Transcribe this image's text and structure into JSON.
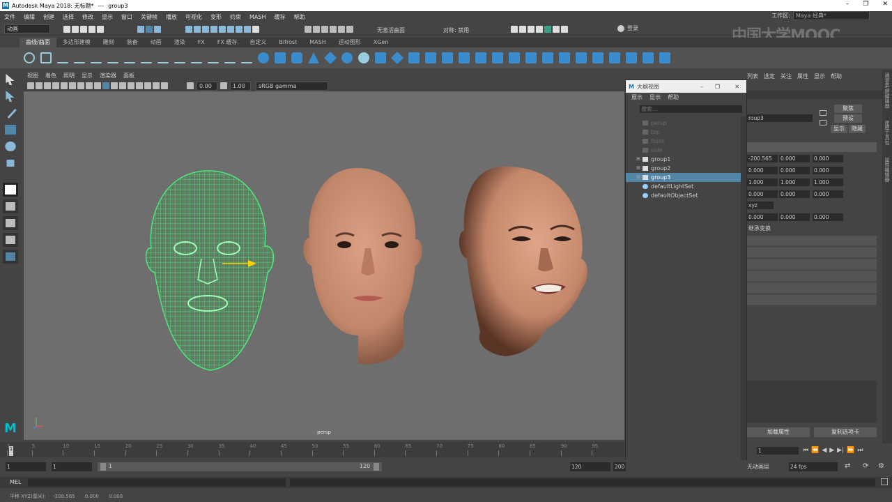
{
  "titlebar": {
    "app": "Autodesk Maya 2018: 无标题*",
    "sep": "---",
    "object": "group3",
    "controls": [
      "–",
      "❐",
      "✕"
    ]
  },
  "menubar": [
    "文件",
    "编辑",
    "创建",
    "选择",
    "修改",
    "显示",
    "窗口",
    "关键帧",
    "播放",
    "可视化",
    "变形",
    "约束",
    "MASH",
    "缓存",
    "帮助"
  ],
  "workspace": {
    "label": "工作区:",
    "value": "Maya 经典*"
  },
  "statusline": {
    "mode": "动画",
    "live_surface": "无激活曲面",
    "symmetry": "对称: 禁用",
    "login": "登录"
  },
  "watermark": "中国大学MOOC",
  "shelf_tabs": [
    "曲线/曲面",
    "多边形建模",
    "雕刻",
    "装备",
    "动画",
    "渲染",
    "FX",
    "FX 缓存",
    "自定义",
    "Bifrost",
    "MASH",
    "运动图形",
    "XGen"
  ],
  "viewport": {
    "menu": [
      "视图",
      "着色",
      "照明",
      "显示",
      "渲染器",
      "面板"
    ],
    "field1": "0.00",
    "field2": "1.00",
    "color_space": "sRGB gamma",
    "camera_label": "persp"
  },
  "outliner": {
    "title": "大纲视图",
    "menu": [
      "展示",
      "显示",
      "帮助"
    ],
    "search_placeholder": "搜索...",
    "items": [
      {
        "name": "persp",
        "dim": true
      },
      {
        "name": "top",
        "dim": true
      },
      {
        "name": "front",
        "dim": true
      },
      {
        "name": "side",
        "dim": true
      },
      {
        "name": "group1",
        "expandable": true
      },
      {
        "name": "group2",
        "expandable": true
      },
      {
        "name": "group3",
        "expandable": true,
        "selected": true
      },
      {
        "name": "defaultLightSet"
      },
      {
        "name": "defaultObjectSet"
      }
    ]
  },
  "attribute_editor": {
    "tabs": [
      "列表",
      "选定",
      "关注",
      "属性",
      "显示",
      "帮助"
    ],
    "object_name": "roup3",
    "buttons": {
      "focus": "聚焦",
      "presets": "预设",
      "show": "显示",
      "hide": "隐藏"
    },
    "rows": [
      [
        "-200.565",
        "0.000",
        "0.000"
      ],
      [
        "0.000",
        "0.000",
        "0.000"
      ],
      [
        "1.000",
        "1.000",
        "1.000"
      ],
      [
        "0.000",
        "0.000",
        "0.000"
      ],
      [
        "0.000",
        "0.000",
        "0.000"
      ]
    ],
    "rotate_order": "xyz",
    "inherit": "继承变换",
    "load_attr": "加载属性",
    "copy_tab": "复制选项卡"
  },
  "right_strip": [
    "通道盒/层编辑器",
    "建模工具包",
    "属性编辑器"
  ],
  "timeline": {
    "ticks": [
      "1",
      "5",
      "10",
      "15",
      "20",
      "25",
      "30",
      "35",
      "40",
      "45",
      "50",
      "55",
      "60",
      "65",
      "70",
      "75",
      "80",
      "85",
      "90",
      "95"
    ],
    "current": "1"
  },
  "range": {
    "start": "1",
    "playback_start": "1",
    "slider_start": "1",
    "slider_end": "120",
    "end": "120",
    "anim_end": "200",
    "anim_layer": "无动画层",
    "fps": "24 fps",
    "frame": "1"
  },
  "mel": {
    "label": "MEL"
  },
  "help": {
    "text": "平移 XYZ(厘米):",
    "v1": "-200.565",
    "v2": "0.000",
    "v3": "0.000"
  },
  "colors": {
    "selected": "#5285a6",
    "wire": "#4ee87a",
    "skin": "#c88c6e",
    "bg": "#6e6e6e"
  }
}
